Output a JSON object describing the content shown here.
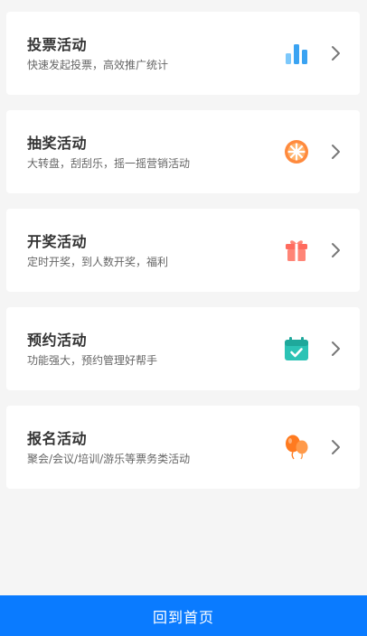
{
  "activities": [
    {
      "title": "投票活动",
      "subtitle": "快速发起投票，高效推广统计",
      "icon": "bar-chart-icon",
      "icon_color": "#41a8f5"
    },
    {
      "title": "抽奖活动",
      "subtitle": "大转盘，刮刮乐，摇一摇营销活动",
      "icon": "prize-wheel-icon",
      "icon_color": "#ff8a3d"
    },
    {
      "title": "开奖活动",
      "subtitle": "定时开奖，到人数开奖，福利",
      "icon": "gift-icon",
      "icon_color": "#ff6b5e"
    },
    {
      "title": "预约活动",
      "subtitle": "功能强大，预约管理好帮手",
      "icon": "calendar-check-icon",
      "icon_color": "#2cc3b5"
    },
    {
      "title": "报名活动",
      "subtitle": "聚会/会议/培训/游乐等票务类活动",
      "icon": "balloon-icon",
      "icon_color": "#ff7a1f"
    }
  ],
  "footer": {
    "home_label": "回到首页",
    "color": "#0a7bff"
  }
}
